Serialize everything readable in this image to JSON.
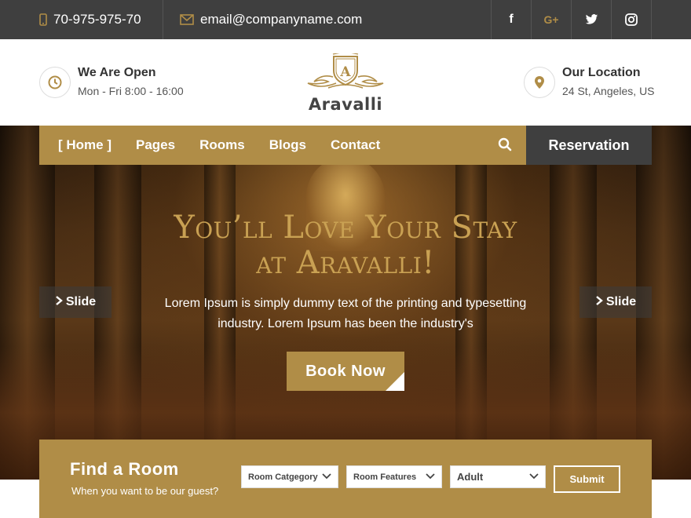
{
  "topbar": {
    "phone": "70-975-975-70",
    "email": "email@companyname.com",
    "social": [
      {
        "icon": "facebook-icon",
        "glyph": "f"
      },
      {
        "icon": "google-plus-icon",
        "glyph": "G+"
      },
      {
        "icon": "twitter-icon",
        "glyph": "t"
      },
      {
        "icon": "instagram-icon",
        "glyph": "◎"
      }
    ]
  },
  "header": {
    "open_title": "We Are Open",
    "open_hours": "Mon - Fri 8:00 - 16:00",
    "logo_letter": "A",
    "logo_text": "Aravalli",
    "location_title": "Our Location",
    "location_address": "24 St, Angeles, US"
  },
  "nav": {
    "items": [
      "[ Home ]",
      "Pages",
      "Rooms",
      "Blogs",
      "Contact"
    ],
    "reservation": "Reservation"
  },
  "hero": {
    "title_line1": "You’ll Love Your Stay",
    "title_line2": "at Aravalli!",
    "subtitle": "Lorem Ipsum is simply dummy text of the printing and typesetting industry. Lorem Ipsum has been the industry's",
    "book_now": "Book Now",
    "slide_left": "Slide",
    "slide_right": "Slide"
  },
  "finder": {
    "title": "Find a Room",
    "subtitle": "When you want to be our guest?",
    "room_category": "Room Catgegory",
    "room_features": "Room Features",
    "guests": "Adult",
    "submit": "Submit"
  },
  "colors": {
    "accent": "#b08d47",
    "dark": "#3f3f3f",
    "title_gold": "#c9a153"
  }
}
